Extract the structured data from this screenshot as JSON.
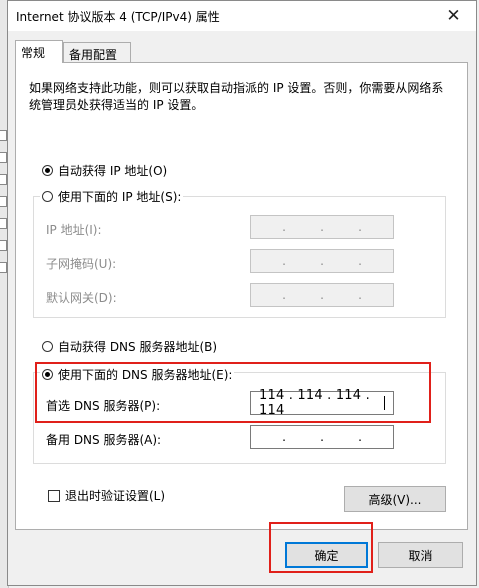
{
  "window": {
    "title": "Internet 协议版本 4 (TCP/IPv4) 属性",
    "close_glyph": "✕"
  },
  "tabs": [
    {
      "label": "常规",
      "active": true
    },
    {
      "label": "备用配置",
      "active": false
    }
  ],
  "description": "如果网络支持此功能，则可以获取自动指派的 IP 设置。否则，你需要从网络系统管理员处获得适当的 IP 设置。",
  "ip": {
    "auto_label": "自动获得 IP 地址(O)",
    "auto_checked": true,
    "manual_label": "使用下面的 IP 地址(S):",
    "manual_checked": false,
    "fields": [
      {
        "label": "IP 地址(I):",
        "value": ""
      },
      {
        "label": "子网掩码(U):",
        "value": ""
      },
      {
        "label": "默认网关(D):",
        "value": ""
      }
    ]
  },
  "dns": {
    "auto_label": "自动获得 DNS 服务器地址(B)",
    "auto_checked": false,
    "manual_label": "使用下面的 DNS 服务器地址(E):",
    "manual_checked": true,
    "preferred_label": "首选 DNS 服务器(P):",
    "preferred_value": "114 . 114 . 114 . 114",
    "alternate_label": "备用 DNS 服务器(A):",
    "alternate_value": ""
  },
  "validate_label": "退出时验证设置(L)",
  "validate_checked": false,
  "buttons": {
    "advanced": "高级(V)...",
    "ok": "确定",
    "cancel": "取消"
  },
  "ip_dot": ".",
  "highlight_color": "#e0201a"
}
